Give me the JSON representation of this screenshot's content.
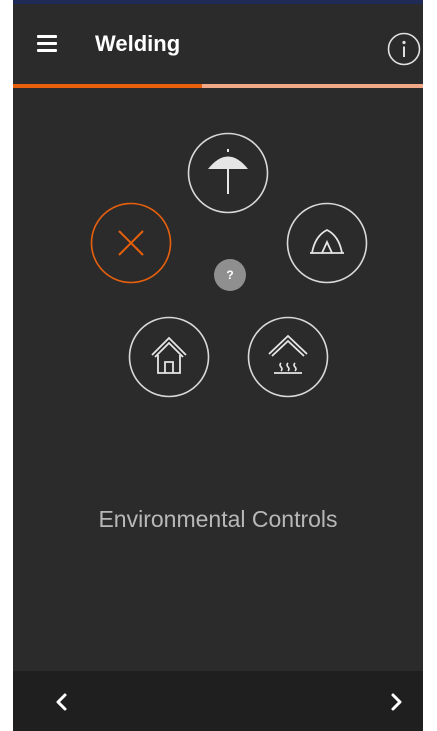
{
  "app": {
    "title": "Welding"
  },
  "progress": {
    "fraction": 0.46
  },
  "controls": [
    {
      "name": "umbrella",
      "icon": "umbrella-icon",
      "selected": false
    },
    {
      "name": "none",
      "icon": "close-icon",
      "selected": true
    },
    {
      "name": "tent",
      "icon": "tent-icon",
      "selected": false
    },
    {
      "name": "house",
      "icon": "house-icon",
      "selected": false
    },
    {
      "name": "heated-enclosure",
      "icon": "heated-house-icon",
      "selected": false
    }
  ],
  "help": {
    "label": "?"
  },
  "caption": "Environmental Controls",
  "colors": {
    "accent": "#e8600c",
    "progress_track": "#f0a888",
    "background": "#2b2b2b",
    "bottom_bar": "#1f1f1f",
    "icon_stroke": "#d9d9d9",
    "help_badge": "#8f8f8f"
  },
  "navigation": {
    "back_icon": "chevron-left-icon",
    "forward_icon": "chevron-right-icon"
  }
}
